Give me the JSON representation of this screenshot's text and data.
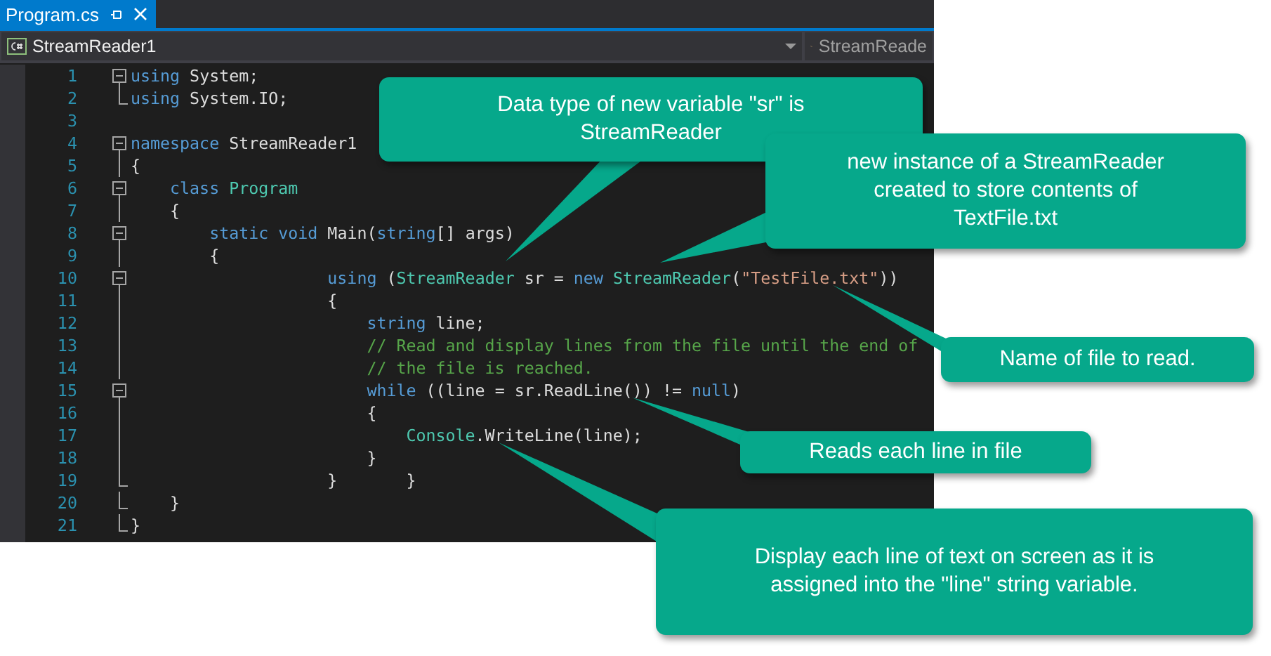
{
  "tab": {
    "title": "Program.cs",
    "selected": true
  },
  "navigation": {
    "project": "StreamReader1",
    "member": "StreamReade"
  },
  "code_lines": [
    {
      "number": "1",
      "kind": "start",
      "tokens": [
        {
          "kind": "keyword",
          "text": "using"
        },
        {
          "kind": "plain",
          "text": " System;"
        }
      ]
    },
    {
      "number": "2",
      "kind": "end",
      "tokens": [
        {
          "kind": "keyword",
          "text": "using"
        },
        {
          "kind": "plain",
          "text": " System.IO;"
        }
      ]
    },
    {
      "number": "3",
      "kind": "plain"
    },
    {
      "number": "4",
      "kind": "start",
      "tokens": [
        {
          "kind": "keyword",
          "text": "namespace"
        },
        {
          "kind": "plain",
          "text": " StreamReader1"
        }
      ]
    },
    {
      "number": "5",
      "kind": "guide",
      "tokens": [
        {
          "kind": "plain",
          "text": "{"
        }
      ]
    },
    {
      "number": "6",
      "kind": "start",
      "tokens": [
        {
          "kind": "keyword",
          "text": "    class"
        },
        {
          "kind": "type",
          "text": " Program"
        }
      ]
    },
    {
      "number": "7",
      "kind": "guide",
      "tokens": [
        {
          "kind": "plain",
          "text": "    {"
        }
      ]
    },
    {
      "number": "8",
      "kind": "start",
      "tokens": [
        {
          "kind": "keyword",
          "text": "        static"
        },
        {
          "kind": "keyword",
          "text": " void"
        },
        {
          "kind": "plain",
          "text": " Main("
        },
        {
          "kind": "keyword",
          "text": "string"
        },
        {
          "kind": "plain",
          "text": "[] args)"
        }
      ]
    },
    {
      "number": "9",
      "kind": "guide",
      "tokens": [
        {
          "kind": "plain",
          "text": "        {"
        }
      ]
    },
    {
      "number": "10",
      "kind": "start",
      "tokens": [
        {
          "kind": "keyword",
          "text": "                    using"
        },
        {
          "kind": "plain",
          "text": " ("
        },
        {
          "kind": "type",
          "text": "StreamReader"
        },
        {
          "kind": "plain",
          "text": " sr = "
        },
        {
          "kind": "keyword",
          "text": "new"
        },
        {
          "kind": "type",
          "text": " StreamReader"
        },
        {
          "kind": "plain",
          "text": "("
        },
        {
          "kind": "string",
          "text": "\"TestFile.txt\""
        },
        {
          "kind": "plain",
          "text": "))"
        }
      ]
    },
    {
      "number": "11",
      "kind": "guide",
      "tokens": [
        {
          "kind": "plain",
          "text": "                    {"
        }
      ]
    },
    {
      "number": "12",
      "kind": "guide",
      "tokens": [
        {
          "kind": "keyword",
          "text": "                        string"
        },
        {
          "kind": "plain",
          "text": " line;"
        }
      ]
    },
    {
      "number": "13",
      "kind": "guide",
      "tokens": [
        {
          "kind": "comment",
          "text": "                        // Read and display lines from the file until the end of"
        }
      ]
    },
    {
      "number": "14",
      "kind": "guide",
      "tokens": [
        {
          "kind": "comment",
          "text": "                        // the file is reached."
        }
      ]
    },
    {
      "number": "15",
      "kind": "start",
      "tokens": [
        {
          "kind": "keyword",
          "text": "                        while"
        },
        {
          "kind": "plain",
          "text": " ((line = sr.ReadLine()) != "
        },
        {
          "kind": "keyword",
          "text": "null"
        },
        {
          "kind": "plain",
          "text": ")"
        }
      ]
    },
    {
      "number": "16",
      "kind": "guide",
      "tokens": [
        {
          "kind": "plain",
          "text": "                        {"
        }
      ]
    },
    {
      "number": "17",
      "kind": "guide",
      "tokens": [
        {
          "kind": "type",
          "text": "                            Console"
        },
        {
          "kind": "plain",
          "text": ".WriteLine(line);"
        }
      ]
    },
    {
      "number": "18",
      "kind": "guide",
      "tokens": [
        {
          "kind": "plain",
          "text": "                        }"
        }
      ]
    },
    {
      "number": "19",
      "kind": "end",
      "tokens": [
        {
          "kind": "plain",
          "text": "                    }       }"
        }
      ]
    },
    {
      "number": "20",
      "kind": "end",
      "tokens": [
        {
          "kind": "plain",
          "text": "    }"
        }
      ]
    },
    {
      "number": "21",
      "kind": "end",
      "tokens": [
        {
          "kind": "plain",
          "text": "}"
        }
      ]
    }
  ],
  "callouts": [
    {
      "text": "Data type of new variable \"sr\" is StreamReader"
    },
    {
      "text": "new instance of a StreamReader created to store contents of TextFile.txt"
    },
    {
      "text": "Name of file to read."
    },
    {
      "text": "Reads each line in file"
    },
    {
      "text": "Display each line of text on screen as it is assigned into the \"line\" string variable."
    }
  ]
}
